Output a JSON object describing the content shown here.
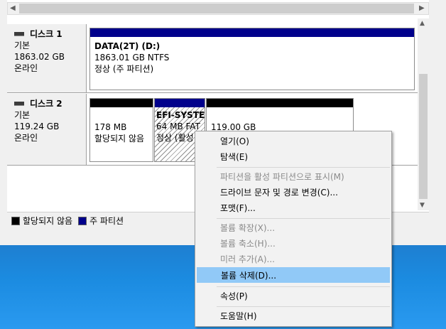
{
  "disks": [
    {
      "name": "디스크 1",
      "type": "기본",
      "size": "1863.02 GB",
      "status": "온라인",
      "partitions": [
        {
          "label": "DATA(2T)  (D:)",
          "size": "1863.01 GB NTFS",
          "status": "정상 (주 파티션)"
        }
      ]
    },
    {
      "name": "디스크 2",
      "type": "기본",
      "size": "119.24 GB",
      "status": "온라인",
      "partitions": [
        {
          "size": "178 MB",
          "status": "할당되지 않음"
        },
        {
          "label": "EFI-SYSTEM",
          "size": "64 MB FAT",
          "status": "정상 (활성"
        },
        {
          "size": "119.00 GB"
        }
      ]
    }
  ],
  "legend": {
    "unallocated": "할당되지 않음",
    "primary": "주 파티션"
  },
  "context_menu": {
    "items": [
      {
        "label": "열기(O)",
        "enabled": true
      },
      {
        "label": "탐색(E)",
        "enabled": true
      },
      {
        "label": "파티션을 활성 파티션으로 표시(M)",
        "enabled": false
      },
      {
        "label": "드라이브 문자 및 경로 변경(C)...",
        "enabled": true
      },
      {
        "label": "포맷(F)...",
        "enabled": true
      },
      {
        "label": "볼륨 확장(X)...",
        "enabled": false
      },
      {
        "label": "볼륨 축소(H)...",
        "enabled": false
      },
      {
        "label": "미러 추가(A)...",
        "enabled": false
      },
      {
        "label": "볼륨 삭제(D)...",
        "enabled": true,
        "highlighted": true
      },
      {
        "label": "속성(P)",
        "enabled": true
      },
      {
        "label": "도움말(H)",
        "enabled": true
      }
    ]
  },
  "colors": {
    "primary_partition": "#00008b",
    "unallocated": "#000000",
    "menu_highlight": "#91c9f7",
    "desktop": "#1b8be0"
  }
}
